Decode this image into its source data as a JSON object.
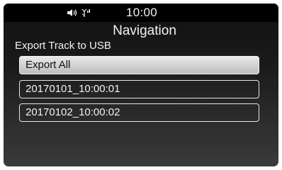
{
  "status_bar": {
    "time": "10:00",
    "icons": [
      "speaker-icon",
      "phone-signal-icon"
    ]
  },
  "header": {
    "title": "Navigation",
    "subtitle": "Export Track to USB"
  },
  "list": {
    "items": [
      {
        "label": "Export All",
        "selected": true
      },
      {
        "label": "20170101_10:00:01",
        "selected": false
      },
      {
        "label": "20170102_10:00:02",
        "selected": false
      }
    ]
  }
}
